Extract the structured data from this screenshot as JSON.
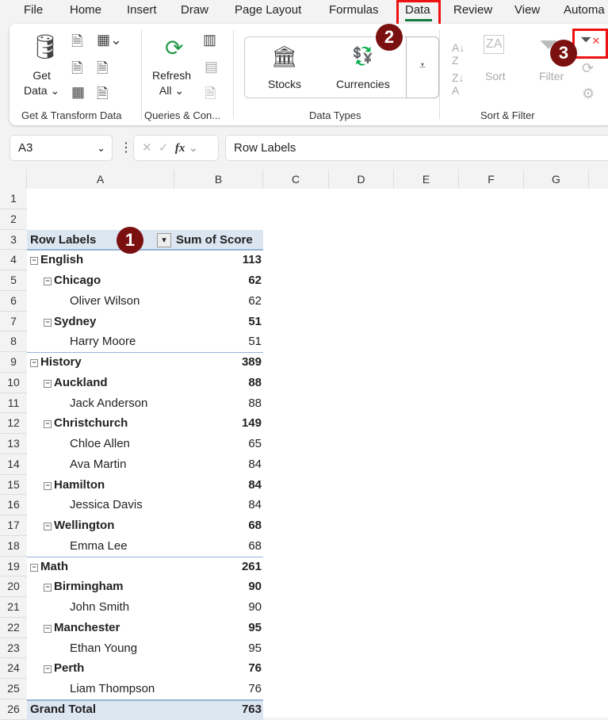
{
  "menu_tabs": [
    "File",
    "Home",
    "Insert",
    "Draw",
    "Page Layout",
    "Formulas",
    "Data",
    "Review",
    "View",
    "Automa"
  ],
  "active_tab": "Data",
  "ribbon": {
    "get_data": [
      "Get",
      "Data ⌄"
    ],
    "refresh_all": [
      "Refresh",
      "All ⌄"
    ],
    "stocks": "Stocks",
    "currencies": "Currencies",
    "sort": "Sort",
    "filter": "Filter",
    "groups": [
      "Get & Transform Data",
      "Queries & Con...",
      "Data Types",
      "Sort & Filter"
    ]
  },
  "markers": [
    "1",
    "2",
    "3"
  ],
  "accent": "#107c41",
  "highlight": "#e11111",
  "formula_bar": {
    "name_box": "A3",
    "fx": "fx",
    "value": "Row Labels"
  },
  "columns": [
    "A",
    "B",
    "C",
    "D",
    "E",
    "F",
    "G"
  ],
  "pivot": {
    "header": {
      "label": "Row Labels",
      "value": "Sum of Score"
    },
    "rows": [
      {
        "level": 0,
        "label": "English",
        "value": "113"
      },
      {
        "level": 1,
        "label": "Chicago",
        "value": "62"
      },
      {
        "level": 2,
        "label": "Oliver Wilson",
        "value": "62"
      },
      {
        "level": 1,
        "label": "Sydney",
        "value": "51"
      },
      {
        "level": 2,
        "label": "Harry Moore",
        "value": "51"
      },
      {
        "level": 0,
        "label": "History",
        "value": "389"
      },
      {
        "level": 1,
        "label": "Auckland",
        "value": "88"
      },
      {
        "level": 2,
        "label": "Jack Anderson",
        "value": "88"
      },
      {
        "level": 1,
        "label": "Christchurch",
        "value": "149"
      },
      {
        "level": 2,
        "label": "Chloe Allen",
        "value": "65"
      },
      {
        "level": 2,
        "label": "Ava Martin",
        "value": "84"
      },
      {
        "level": 1,
        "label": "Hamilton",
        "value": "84"
      },
      {
        "level": 2,
        "label": "Jessica Davis",
        "value": "84"
      },
      {
        "level": 1,
        "label": "Wellington",
        "value": "68"
      },
      {
        "level": 2,
        "label": "Emma Lee",
        "value": "68"
      },
      {
        "level": 0,
        "label": "Math",
        "value": "261"
      },
      {
        "level": 1,
        "label": "Birmingham",
        "value": "90"
      },
      {
        "level": 2,
        "label": "John Smith",
        "value": "90"
      },
      {
        "level": 1,
        "label": "Manchester",
        "value": "95"
      },
      {
        "level": 2,
        "label": "Ethan Young",
        "value": "95"
      },
      {
        "level": 1,
        "label": "Perth",
        "value": "76"
      },
      {
        "level": 2,
        "label": "Liam Thompson",
        "value": "76"
      }
    ],
    "grand_total": {
      "label": "Grand Total",
      "value": "763"
    }
  }
}
